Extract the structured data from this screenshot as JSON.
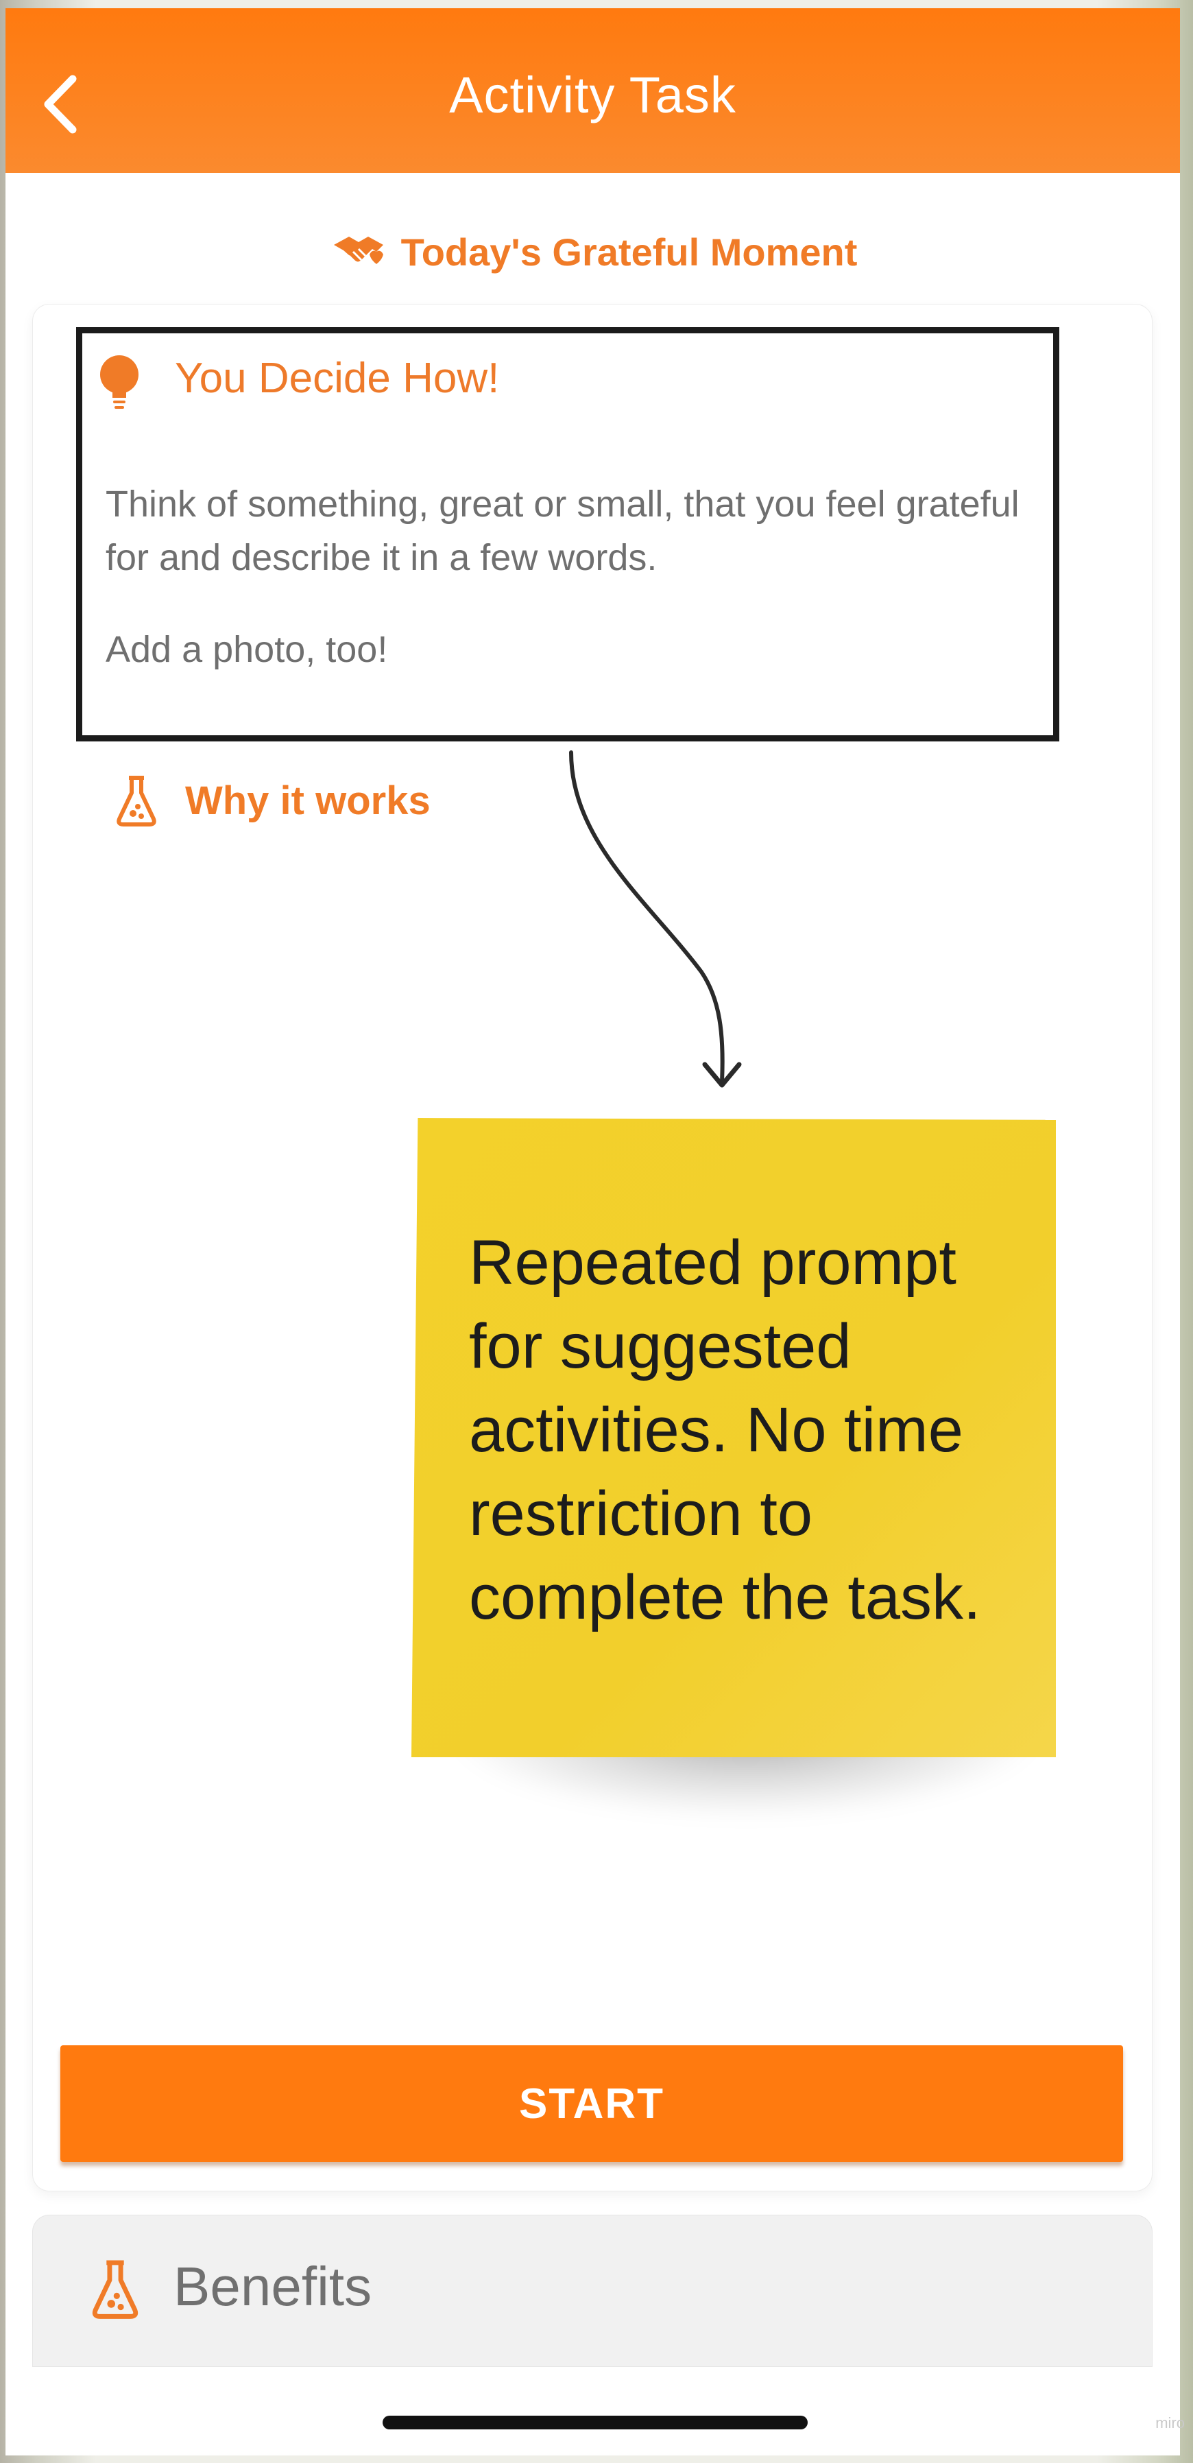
{
  "header": {
    "title": "Activity Task"
  },
  "moment": {
    "label": "Today's Grateful Moment"
  },
  "prompt": {
    "title": "You Decide How!",
    "description": "Think of something, great or small, that you feel grateful for and describe it in a few words.",
    "extra": "Add a photo, too!"
  },
  "why": {
    "label": "Why it works"
  },
  "annotation": {
    "note": "Repeated prompt for suggested activities. No time restriction to complete the task."
  },
  "actions": {
    "start_label": "START"
  },
  "benefits": {
    "label": "Benefits"
  },
  "watermark": "miro",
  "colors": {
    "accent": "#ff7a0f",
    "accent_text": "#f07b27",
    "sticky": "#f3d12b"
  },
  "icons": {
    "back": "chevron-left-icon",
    "moment": "handshake-heart-icon",
    "prompt": "lightbulb-icon",
    "why": "flask-icon",
    "benefits": "flask-icon"
  }
}
